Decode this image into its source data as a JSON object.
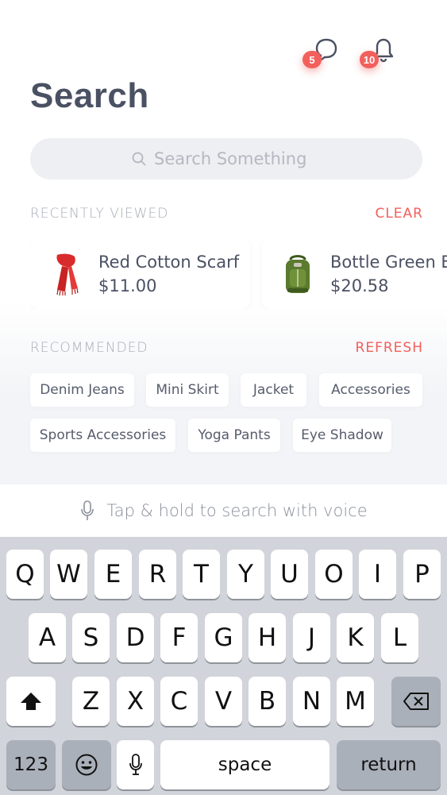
{
  "header": {
    "title": "Search",
    "messages_badge": "5",
    "notifications_badge": "10"
  },
  "search": {
    "placeholder": "Search Something",
    "value": ""
  },
  "recently_viewed": {
    "label": "RECENTLY VIEWED",
    "action": "CLEAR",
    "items": [
      {
        "name": "Red Cotton Scarf",
        "price": "$11.00",
        "icon": "scarf-icon"
      },
      {
        "name": "Bottle Green Ba",
        "price": "$20.58",
        "icon": "backpack-icon"
      }
    ]
  },
  "recommended": {
    "label": "RECOMMENDED",
    "action": "REFRESH",
    "chips": [
      "Denim Jeans",
      "Mini Skirt",
      "Jacket",
      "Accessories",
      "Sports Accessories",
      "Yoga Pants",
      "Eye Shadow"
    ]
  },
  "voice": {
    "hint": "Tap & hold to search with voice",
    "icon": "microphone-icon"
  },
  "keyboard": {
    "row1": [
      "Q",
      "W",
      "E",
      "R",
      "T",
      "Y",
      "U",
      "O",
      "I",
      "P"
    ],
    "row2": [
      "A",
      "S",
      "D",
      "F",
      "G",
      "H",
      "J",
      "K",
      "L"
    ],
    "row3": [
      "Z",
      "X",
      "C",
      "V",
      "B",
      "N",
      "M"
    ],
    "numbers": "123",
    "space": "space",
    "return": "return"
  },
  "colors": {
    "accent": "#f25f5c",
    "text": "#4a5163",
    "muted": "#a9adb7",
    "keyboard_bg": "#d1d4da"
  }
}
